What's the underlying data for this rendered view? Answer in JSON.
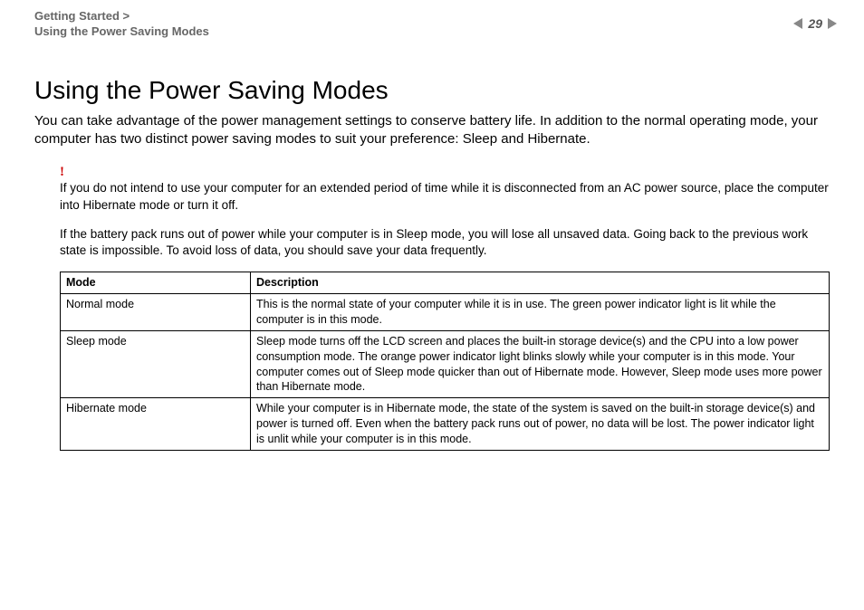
{
  "breadcrumb": {
    "line1": "Getting Started >",
    "line2": "Using the Power Saving Modes"
  },
  "page_number": "29",
  "title": "Using the Power Saving Modes",
  "intro": "You can take advantage of the power management settings to conserve battery life. In addition to the normal operating mode, your computer has two distinct power saving modes to suit your preference: Sleep and Hibernate.",
  "warning_mark": "!",
  "note1": "If you do not intend to use your computer for an extended period of time while it is disconnected from an AC power source, place the computer into Hibernate mode or turn it off.",
  "note2": "If the battery pack runs out of power while your computer is in Sleep mode, you will lose all unsaved data. Going back to the previous work state is impossible. To avoid loss of data, you should save your data frequently.",
  "table": {
    "headers": {
      "mode": "Mode",
      "desc": "Description"
    },
    "rows": [
      {
        "mode": "Normal mode",
        "desc": "This is the normal state of your computer while it is in use. The green power indicator light is lit while the computer is in this mode."
      },
      {
        "mode": "Sleep mode",
        "desc": "Sleep mode turns off the LCD screen and places the built-in storage device(s) and the CPU into a low power consumption mode. The orange power indicator light blinks slowly while your computer is in this mode. Your computer comes out of Sleep mode quicker than out of Hibernate mode. However, Sleep mode uses more power than Hibernate mode."
      },
      {
        "mode": "Hibernate mode",
        "desc": "While your computer is in Hibernate mode, the state of the system is saved on the built-in storage device(s) and power is turned off. Even when the battery pack runs out of power, no data will be lost. The power indicator light is unlit while your computer is in this mode."
      }
    ]
  }
}
